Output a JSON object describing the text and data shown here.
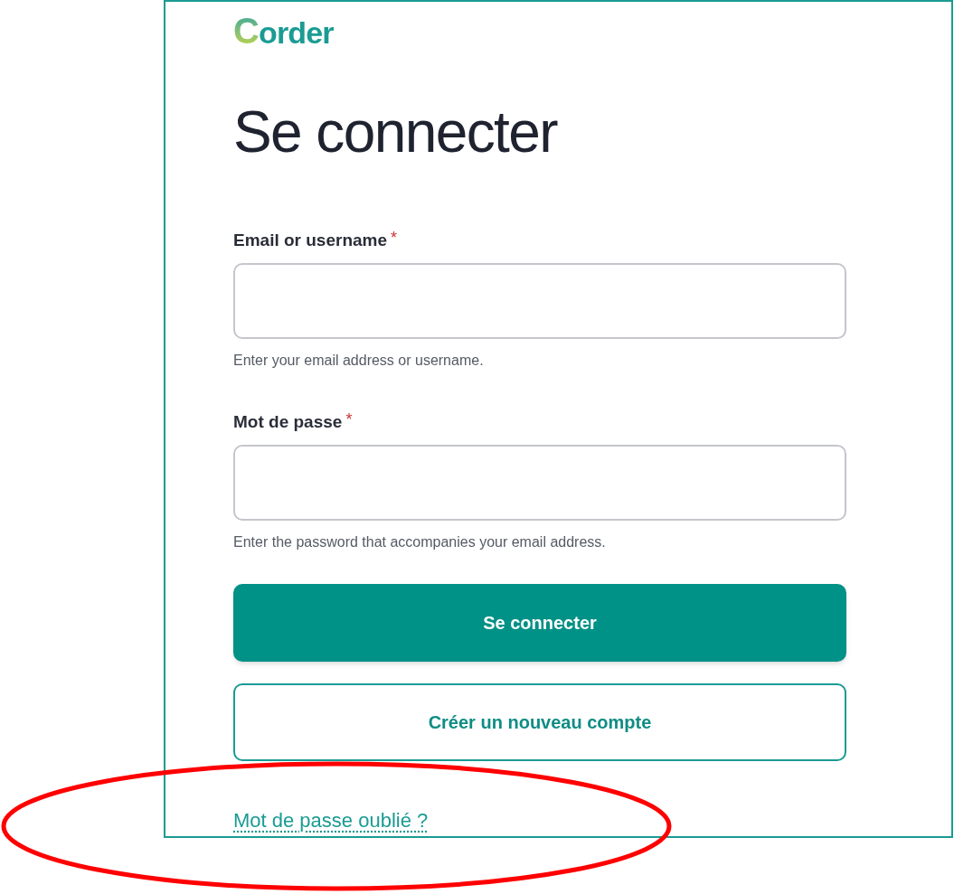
{
  "logo": {
    "initial": "C",
    "rest": "order"
  },
  "title": "Se connecter",
  "fields": [
    {
      "label": "Email or username",
      "required": true,
      "required_mark": "*",
      "help": "Enter your email address or username."
    },
    {
      "label": "Mot de passe",
      "required": true,
      "required_mark": "*",
      "help": "Enter the password that accompanies your email address."
    }
  ],
  "buttons": [
    {
      "label": "Se connecter",
      "kind": "primary"
    },
    {
      "label": "Créer un nouveau compte",
      "kind": "secondary"
    }
  ],
  "forgot_link": "Mot de passe oublié ?"
}
